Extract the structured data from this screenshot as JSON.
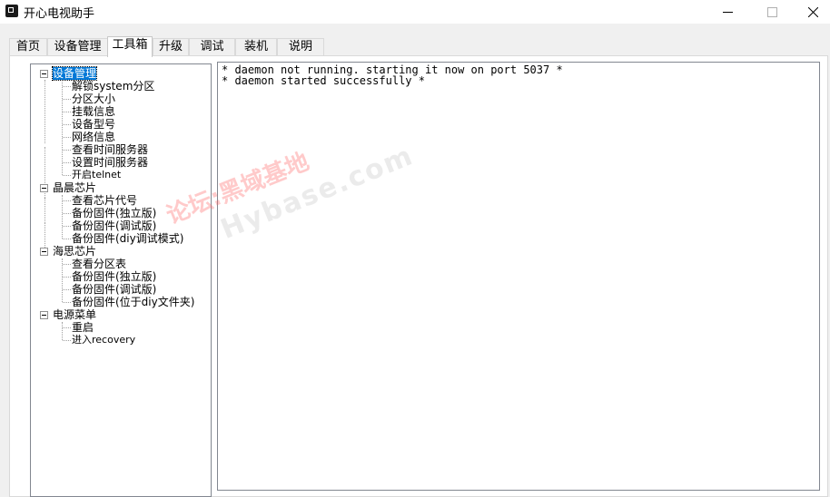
{
  "window": {
    "title": "开心电视助手",
    "icon": "app-icon",
    "minimize_glyph": "—",
    "maximize_glyph": "☐",
    "close_glyph": "✕"
  },
  "tabs": [
    {
      "label": "首页",
      "active": false
    },
    {
      "label": "设备管理",
      "active": false
    },
    {
      "label": "工具箱",
      "active": true
    },
    {
      "label": "升级",
      "active": false
    },
    {
      "label": "调试",
      "active": false
    },
    {
      "label": "装机",
      "active": false
    },
    {
      "label": "说明",
      "active": false
    }
  ],
  "tree": {
    "groups": [
      {
        "label": "设备管理",
        "selected": true,
        "children": [
          "解锁system分区",
          "分区大小",
          "挂载信息",
          "设备型号",
          "网络信息",
          "查看时间服务器",
          "设置时间服务器",
          "开启telnet"
        ]
      },
      {
        "label": "晶晨芯片",
        "selected": false,
        "children": [
          "查看芯片代号",
          "备份固件(独立版)",
          "备份固件(调试版)",
          "备份固件(diy调试模式)"
        ]
      },
      {
        "label": "海思芯片",
        "selected": false,
        "children": [
          "查看分区表",
          "备份固件(独立版)",
          "备份固件(调试版)",
          "备份固件(位于diy文件夹)"
        ]
      },
      {
        "label": "电源菜单",
        "selected": false,
        "children": [
          "重启",
          "进入recovery"
        ]
      }
    ]
  },
  "log": {
    "lines": [
      "* daemon not running. starting it now on port 5037 *",
      "* daemon started successfully *"
    ]
  },
  "watermark": {
    "line1": "论坛:黑域基地",
    "line2": "Hybase.com"
  }
}
